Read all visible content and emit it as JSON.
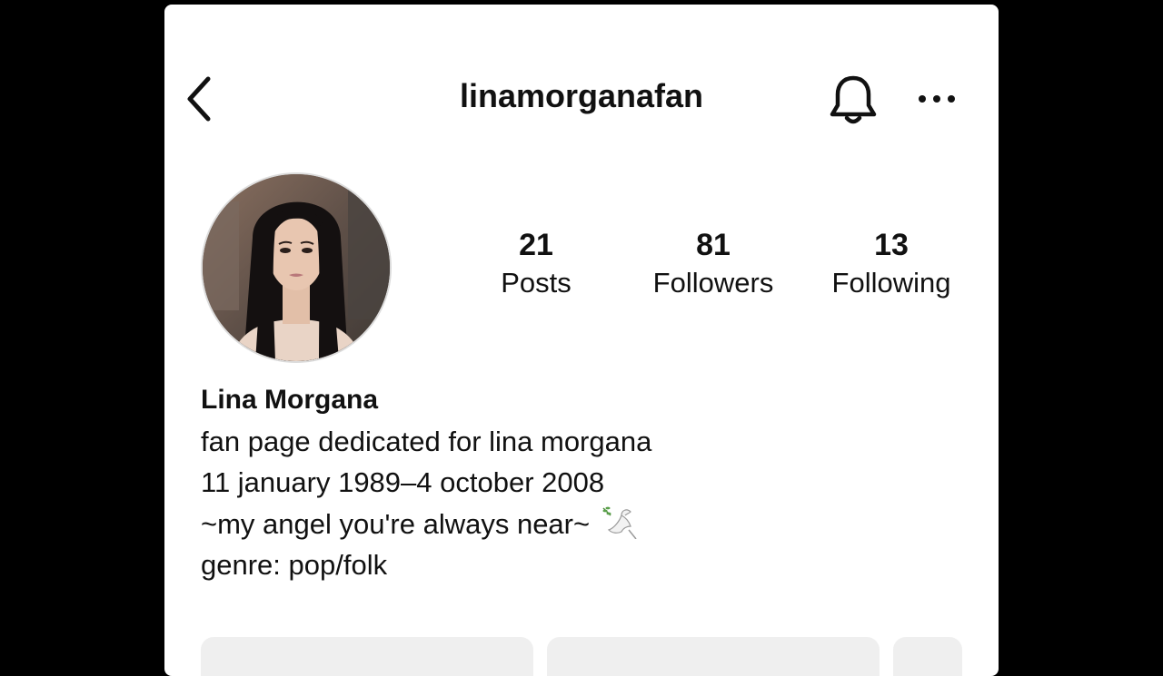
{
  "header": {
    "username": "linamorganafan",
    "back_icon": "chevron-left-icon",
    "notify_icon": "bell-icon",
    "more_icon": "more-horizontal-icon"
  },
  "stats": {
    "posts": {
      "value": "21",
      "label": "Posts"
    },
    "followers": {
      "value": "81",
      "label": "Followers"
    },
    "following": {
      "value": "13",
      "label": "Following"
    }
  },
  "bio": {
    "name": "Lina Morgana",
    "line1": "fan page dedicated for lina morgana",
    "line2": "11 january 1989–4 october 2008",
    "line3": "~my angel you're always near~",
    "line3_emoji": "dove-icon",
    "line4": "genre: pop/folk"
  },
  "colors": {
    "background": "#000000",
    "screen": "#ffffff",
    "text": "#111111",
    "button": "#efefef"
  }
}
